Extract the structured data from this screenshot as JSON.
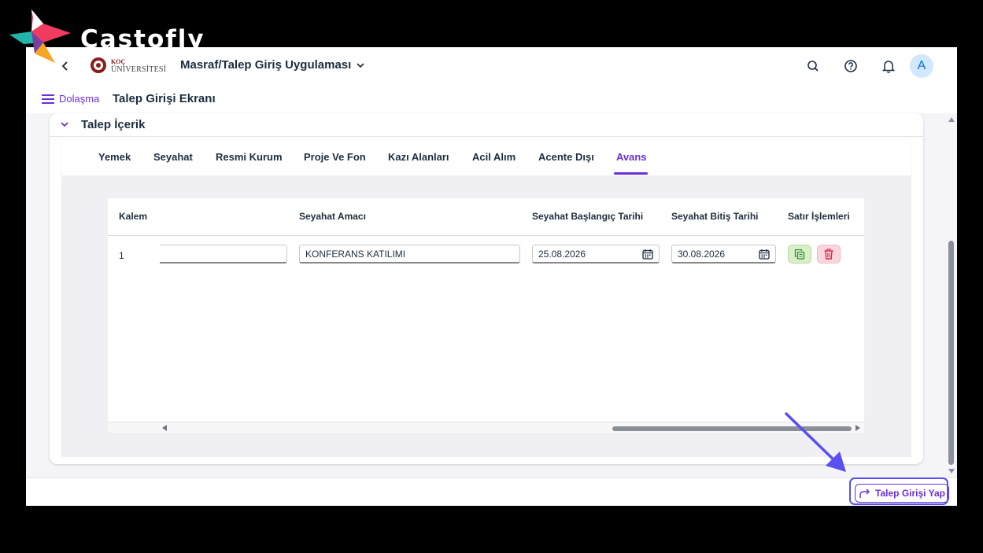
{
  "brand": {
    "name": "Castofly"
  },
  "shellbar": {
    "logo_koc": "KOÇ",
    "logo_uni": "ÜNİVERSİTESİ",
    "app_title": "Masraf/Talep Giriş Uygulaması",
    "avatar_initial": "A",
    "icons": [
      "back-chevron-icon",
      "search-icon",
      "help-icon",
      "bell-icon"
    ]
  },
  "subheader": {
    "nav_label": "Dolaşma",
    "page_title": "Talep Girişi Ekranı"
  },
  "panel": {
    "title": "Talep İçerik",
    "tabs": [
      {
        "label": "Yemek"
      },
      {
        "label": "Seyahat"
      },
      {
        "label": "Resmi Kurum"
      },
      {
        "label": "Proje Ve Fon"
      },
      {
        "label": "Kazı Alanları"
      },
      {
        "label": "Acil Alım"
      },
      {
        "label": "Acente Dışı"
      },
      {
        "label": "Avans"
      }
    ],
    "active_tab": "Avans"
  },
  "table": {
    "columns": [
      "Kalem",
      "Seyahat Amacı",
      "Seyahat Başlangıç Tarihi",
      "Seyahat Bitiş Tarihi",
      "Satır İşlemleri"
    ],
    "rows": [
      {
        "kalem": "1",
        "field_1": "",
        "seyahat_amaci": "KONFERANS KATILIMI",
        "baslangic": "25.08.2026",
        "bitis": "30.08.2026"
      }
    ]
  },
  "footer": {
    "submit_label": "Talep Girişi Yap"
  },
  "colors": {
    "accent": "#6a2fd6",
    "annotation": "#5a4ff0",
    "copy_button_bg": "#d8f0c8",
    "delete_button_bg": "#fbd6de"
  }
}
